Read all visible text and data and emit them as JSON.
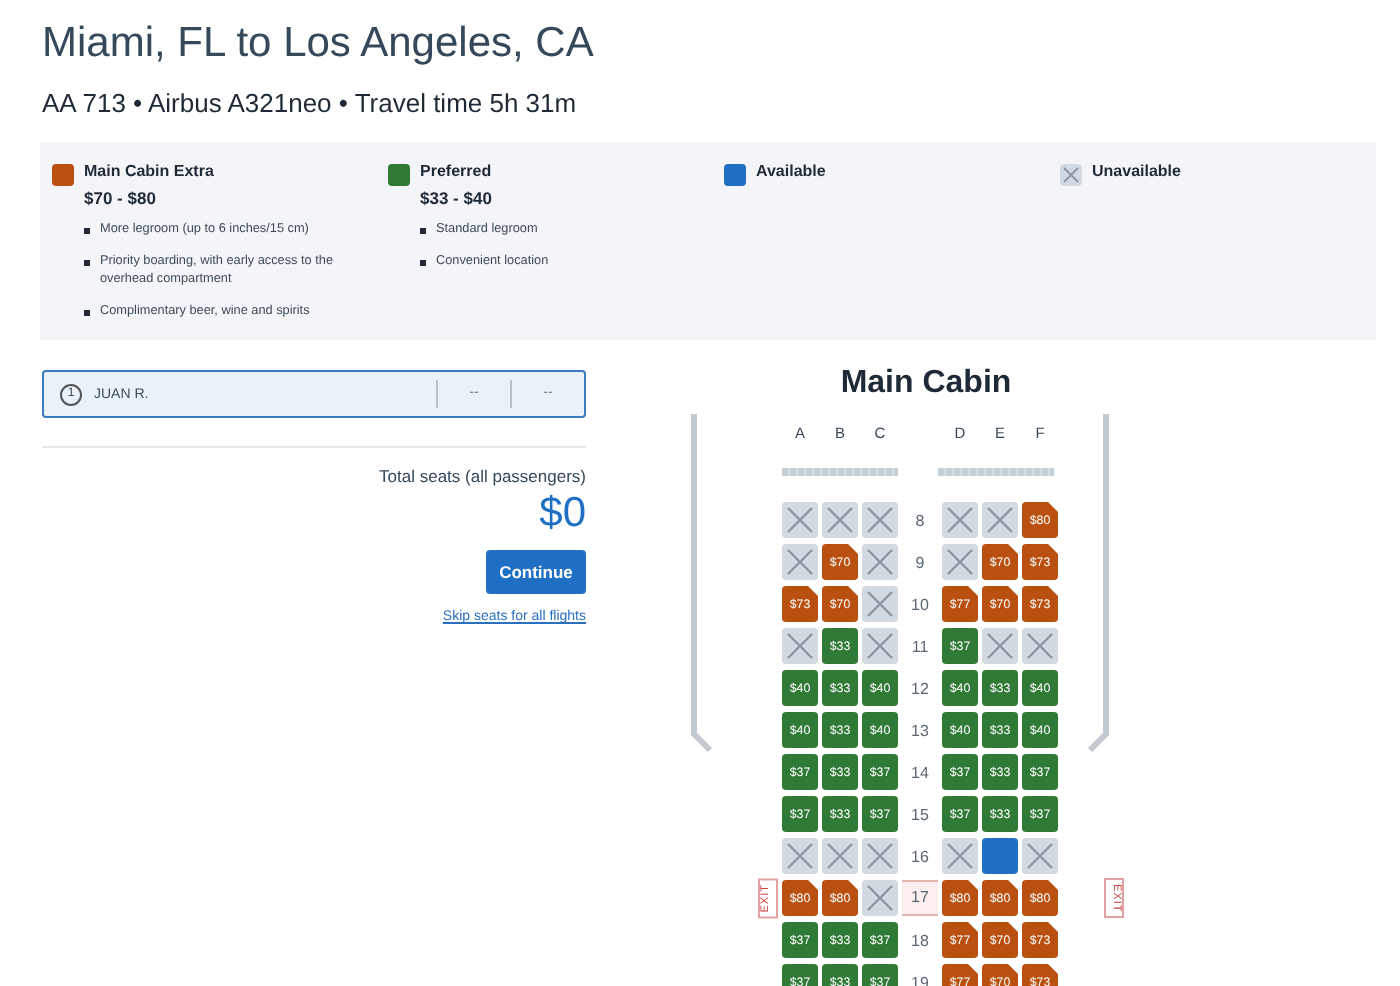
{
  "title": "Miami, FL to Los Angeles, CA",
  "subtitle": "AA 713 • Airbus A321neo • Travel time 5h 31m",
  "legend": [
    {
      "kind": "extra",
      "name": "Main Cabin Extra",
      "price": "$70 - $80",
      "features": [
        "More legroom (up to 6 inches/15 cm)",
        "Priority boarding, with early access to the overhead compartment",
        "Complimentary beer, wine and spirits"
      ]
    },
    {
      "kind": "preferred",
      "name": "Preferred",
      "price": "$33 - $40",
      "features": [
        "Standard legroom",
        "Convenient location"
      ]
    },
    {
      "kind": "available",
      "name": "Available"
    },
    {
      "kind": "unavailable",
      "name": "Unavailable"
    }
  ],
  "passenger": {
    "number": "1",
    "name": "JUAN R.",
    "seat": "--",
    "price": "--"
  },
  "total": {
    "label": "Total seats (all passengers)",
    "amount": "$0"
  },
  "continue_button": "Continue",
  "skip_link": "Skip seats for all flights",
  "cabin": {
    "title": "Main Cabin",
    "left_columns": [
      "A",
      "B",
      "C"
    ],
    "right_columns": [
      "D",
      "E",
      "F"
    ],
    "rows": [
      {
        "number": "8",
        "exit": false,
        "seats": [
          {
            "kind": "unavailable"
          },
          {
            "kind": "unavailable"
          },
          {
            "kind": "unavailable"
          },
          {
            "kind": "unavailable"
          },
          {
            "kind": "unavailable"
          },
          {
            "kind": "extra",
            "price": "$80"
          }
        ]
      },
      {
        "number": "9",
        "exit": false,
        "seats": [
          {
            "kind": "unavailable"
          },
          {
            "kind": "extra",
            "price": "$70"
          },
          {
            "kind": "unavailable"
          },
          {
            "kind": "unavailable"
          },
          {
            "kind": "extra",
            "price": "$70"
          },
          {
            "kind": "extra",
            "price": "$73"
          }
        ]
      },
      {
        "number": "10",
        "exit": false,
        "seats": [
          {
            "kind": "extra",
            "price": "$73"
          },
          {
            "kind": "extra",
            "price": "$70"
          },
          {
            "kind": "unavailable"
          },
          {
            "kind": "extra",
            "price": "$77"
          },
          {
            "kind": "extra",
            "price": "$70"
          },
          {
            "kind": "extra",
            "price": "$73"
          }
        ]
      },
      {
        "number": "11",
        "exit": false,
        "seats": [
          {
            "kind": "unavailable"
          },
          {
            "kind": "preferred",
            "price": "$33"
          },
          {
            "kind": "unavailable"
          },
          {
            "kind": "preferred",
            "price": "$37"
          },
          {
            "kind": "unavailable"
          },
          {
            "kind": "unavailable"
          }
        ]
      },
      {
        "number": "12",
        "exit": false,
        "seats": [
          {
            "kind": "preferred",
            "price": "$40"
          },
          {
            "kind": "preferred",
            "price": "$33"
          },
          {
            "kind": "preferred",
            "price": "$40"
          },
          {
            "kind": "preferred",
            "price": "$40"
          },
          {
            "kind": "preferred",
            "price": "$33"
          },
          {
            "kind": "preferred",
            "price": "$40"
          }
        ]
      },
      {
        "number": "13",
        "exit": false,
        "seats": [
          {
            "kind": "preferred",
            "price": "$40"
          },
          {
            "kind": "preferred",
            "price": "$33"
          },
          {
            "kind": "preferred",
            "price": "$40"
          },
          {
            "kind": "preferred",
            "price": "$40"
          },
          {
            "kind": "preferred",
            "price": "$33"
          },
          {
            "kind": "preferred",
            "price": "$40"
          }
        ]
      },
      {
        "number": "14",
        "exit": false,
        "seats": [
          {
            "kind": "preferred",
            "price": "$37"
          },
          {
            "kind": "preferred",
            "price": "$33"
          },
          {
            "kind": "preferred",
            "price": "$37"
          },
          {
            "kind": "preferred",
            "price": "$37"
          },
          {
            "kind": "preferred",
            "price": "$33"
          },
          {
            "kind": "preferred",
            "price": "$37"
          }
        ]
      },
      {
        "number": "15",
        "exit": false,
        "seats": [
          {
            "kind": "preferred",
            "price": "$37"
          },
          {
            "kind": "preferred",
            "price": "$33"
          },
          {
            "kind": "preferred",
            "price": "$37"
          },
          {
            "kind": "preferred",
            "price": "$37"
          },
          {
            "kind": "preferred",
            "price": "$33"
          },
          {
            "kind": "preferred",
            "price": "$37"
          }
        ]
      },
      {
        "number": "16",
        "exit": false,
        "seats": [
          {
            "kind": "unavailable"
          },
          {
            "kind": "unavailable"
          },
          {
            "kind": "unavailable"
          },
          {
            "kind": "unavailable"
          },
          {
            "kind": "available"
          },
          {
            "kind": "unavailable"
          }
        ]
      },
      {
        "number": "17",
        "exit": true,
        "exit_signs": [
          "EXIT",
          "EXIT"
        ],
        "seats": [
          {
            "kind": "extra",
            "price": "$80"
          },
          {
            "kind": "extra",
            "price": "$80"
          },
          {
            "kind": "unavailable"
          },
          {
            "kind": "extra",
            "price": "$80"
          },
          {
            "kind": "extra",
            "price": "$80"
          },
          {
            "kind": "extra",
            "price": "$80"
          }
        ]
      },
      {
        "number": "18",
        "exit": false,
        "seats": [
          {
            "kind": "preferred",
            "price": "$37"
          },
          {
            "kind": "preferred",
            "price": "$33"
          },
          {
            "kind": "preferred",
            "price": "$37"
          },
          {
            "kind": "extra",
            "price": "$77"
          },
          {
            "kind": "extra",
            "price": "$70"
          },
          {
            "kind": "extra",
            "price": "$73"
          }
        ]
      },
      {
        "number": "19",
        "exit": false,
        "seats": [
          {
            "kind": "preferred",
            "price": "$37"
          },
          {
            "kind": "preferred",
            "price": "$33"
          },
          {
            "kind": "preferred",
            "price": "$37"
          },
          {
            "kind": "extra",
            "price": "$77"
          },
          {
            "kind": "extra",
            "price": "$70"
          },
          {
            "kind": "extra",
            "price": "$73"
          }
        ]
      }
    ]
  }
}
